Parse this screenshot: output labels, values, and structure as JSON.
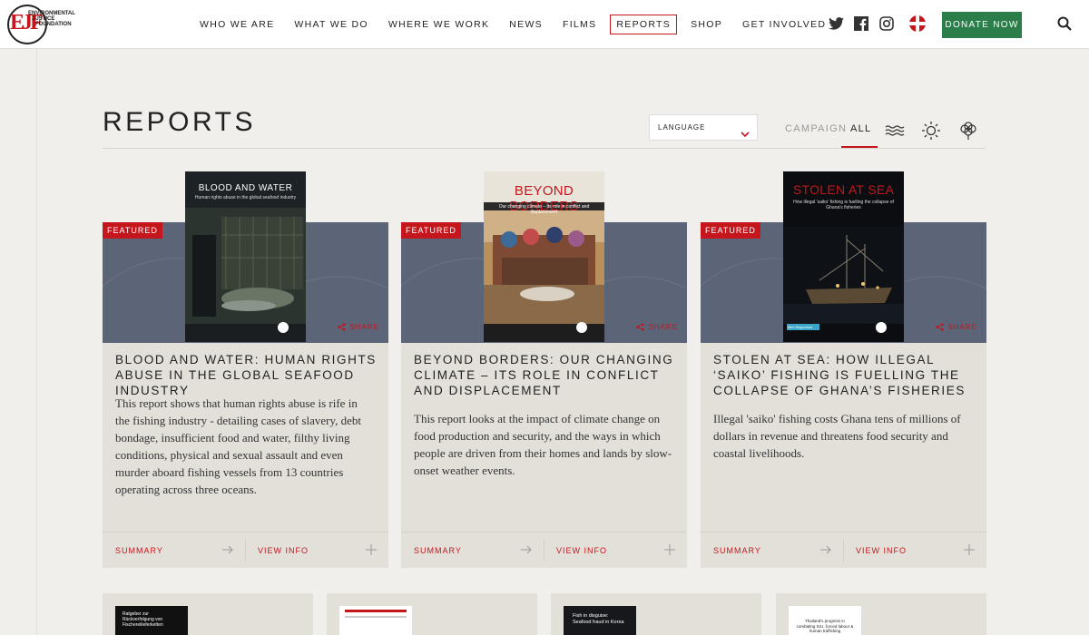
{
  "brand": {
    "logo_mark": "EJF",
    "logo_lines": [
      "ENVIRONMENTAL",
      "JUSTICE",
      "FOUNDATION"
    ]
  },
  "nav": {
    "items": [
      "WHO WE ARE",
      "WHAT WE DO",
      "WHERE WE WORK",
      "NEWS",
      "FILMS",
      "REPORTS",
      "SHOP",
      "GET INVOLVED"
    ],
    "active": "REPORTS",
    "donate_label": "DONATE NOW"
  },
  "icons": {
    "social": [
      "twitter-icon",
      "facebook-icon",
      "instagram-icon"
    ],
    "language_flag": "uk-flag-icon",
    "search": "search-icon",
    "filters": [
      "waves-icon",
      "sun-icon",
      "cotton-icon"
    ]
  },
  "colors": {
    "accent": "#c4161c",
    "donate": "#2b7d4a",
    "banner": "#5c6577",
    "page_bg": "#f1efeb",
    "card_bg": "#e3e0da"
  },
  "page": {
    "title": "REPORTS",
    "language_label": "LANGUAGE",
    "filter_campaign": "CAMPAIGN",
    "filter_all": "ALL"
  },
  "cards": [
    {
      "badge": "FEATURED",
      "share": "SHARE",
      "cover_title": "BLOOD AND WATER",
      "cover_subtitle": "Human rights abuse in the global seafood industry",
      "title": "BLOOD AND WATER: HUMAN RIGHTS ABUSE IN THE GLOBAL SEAFOOD INDUSTRY",
      "description": "This report shows that human rights abuse is rife in the fishing industry - detailing cases of slavery, debt bondage, insufficient food and water, filthy living conditions, physical and sexual assault and even murder aboard fishing vessels from 13 countries operating across three oceans.",
      "summary_label": "SUMMARY",
      "info_label": "VIEW INFO"
    },
    {
      "badge": "FEATURED",
      "share": "SHARE",
      "cover_title": "BEYOND BORDERS",
      "cover_subtitle": "Our changing climate – its role in conflict and displacement",
      "title": "BEYOND BORDERS: OUR CHANGING CLIMATE – ITS ROLE IN CONFLICT AND DISPLACEMENT",
      "description": "This report looks at the impact of climate change on food production and security, and the ways in which people are driven from their homes and lands by slow-onset weather events.",
      "summary_label": "SUMMARY",
      "info_label": "VIEW INFO"
    },
    {
      "badge": "FEATURED",
      "share": "SHARE",
      "cover_title": "STOLEN AT SEA",
      "cover_subtitle": "How illegal 'saiko' fishing is fuelling the collapse of Ghana's fisheries",
      "cover_tag": "Mini Wąsovska",
      "title": "STOLEN AT SEA: HOW ILLEGAL ‘SAIKO’ FISHING IS FUELLING THE COLLAPSE OF GHANA’S FISHERIES",
      "description": "Illegal 'saiko' fishing costs Ghana tens of millions of dollars in revenue and threatens food security and coastal livelihoods.",
      "summary_label": "SUMMARY",
      "info_label": "VIEW INFO"
    }
  ],
  "bottom_covers": [
    {
      "title": "Ratgeber zur Rückverfolgung von Fischereilieferketten"
    },
    {
      "title": "Document cover"
    },
    {
      "title": "Fish in disguise: Seafood fraud in Korea"
    },
    {
      "title": "Thailand's progress in combating IUU, forced labour & human trafficking"
    }
  ]
}
